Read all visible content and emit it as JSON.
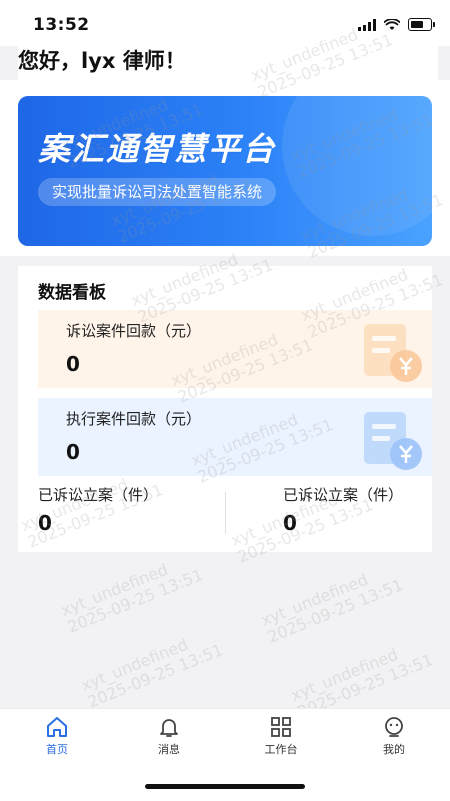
{
  "status_bar": {
    "time": "13:52"
  },
  "greeting": "您好，lyx 律师！",
  "banner": {
    "title": "案汇通智慧平台",
    "subtitle": "实现批量诉讼司法处置智能系统"
  },
  "dashboard": {
    "title": "数据看板",
    "cards": [
      {
        "label": "诉讼案件回款（元）",
        "value": "0",
        "accent": "#fff4ea"
      },
      {
        "label": "执行案件回款（元）",
        "value": "0",
        "accent": "#eaf3ff"
      }
    ],
    "stats": [
      {
        "label": "已诉讼立案（件）",
        "value": "0"
      },
      {
        "label": "已诉讼立案（件）",
        "value": "0"
      }
    ]
  },
  "tabs": [
    {
      "label": "首页",
      "icon": "home-icon",
      "active": true
    },
    {
      "label": "消息",
      "icon": "bell-icon",
      "active": false
    },
    {
      "label": "工作台",
      "icon": "grid-icon",
      "active": false
    },
    {
      "label": "我的",
      "icon": "profile-icon",
      "active": false
    }
  ],
  "watermark": {
    "user": "xyt_undefined",
    "time": "2025-09-25 13:51"
  },
  "colors": {
    "accent": "#2b6fe5",
    "banner_start": "#1e67e6",
    "banner_end": "#4aa2ff"
  }
}
